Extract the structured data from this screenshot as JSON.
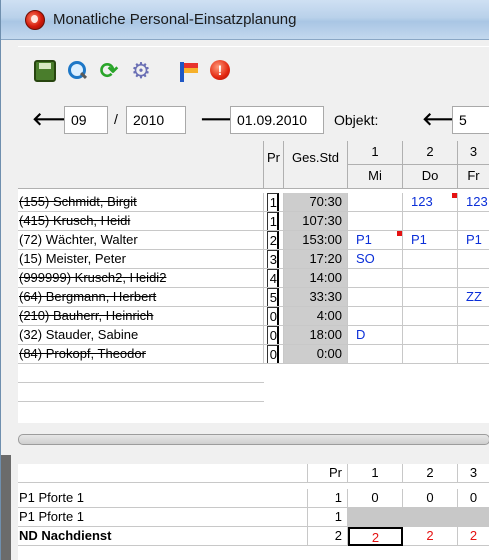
{
  "window": {
    "title": "Monatliche Personal-Einsatzplanung"
  },
  "toolbar": {
    "icons": [
      "save-icon",
      "search-icon",
      "refresh-icon",
      "settings-gear-icon",
      "legend-flag-icon",
      "stop-icon"
    ],
    "stop_glyph": "!"
  },
  "nav": {
    "prev_arrow": "🡐",
    "next_arrow": "🡒",
    "month": "09",
    "separator": "/",
    "year": "2010",
    "date": "01.09.2010",
    "object_label": "Objekt:",
    "object_prev_arrow": "🡐",
    "object_value": "5"
  },
  "grid": {
    "headers": {
      "pr": "Pr",
      "std": "Ges.Std"
    },
    "days": [
      {
        "num": "1",
        "weekday": "Mi"
      },
      {
        "num": "2",
        "weekday": "Do"
      },
      {
        "num": "3",
        "weekday": "Fr"
      }
    ],
    "rows": [
      {
        "name": "(155) Schmidt, Birgit",
        "strike": true,
        "pr": "1",
        "std": "70:30",
        "d1": "",
        "d2": "123",
        "d3": "123",
        "mark2": true
      },
      {
        "name": "(415) Krusch, Heidi",
        "strike": true,
        "pr": "1",
        "std": "107:30",
        "d1": "",
        "d2": "",
        "d3": ""
      },
      {
        "name": "(72) Wächter, Walter",
        "strike": false,
        "pr": "2",
        "std": "153:00",
        "d1": "P1",
        "d2": "P1",
        "d3": "P1",
        "mark1": true
      },
      {
        "name": "(15) Meister, Peter",
        "strike": false,
        "pr": "3",
        "std": "17:20",
        "d1": "SO",
        "d2": "",
        "d3": ""
      },
      {
        "name": "(999999) Krusch2, Heidi2",
        "strike": true,
        "pr": "4",
        "std": "14:00",
        "d1": "",
        "d2": "",
        "d3": ""
      },
      {
        "name": "(64) Bergmann, Herbert",
        "strike": true,
        "pr": "5",
        "std": "33:30",
        "d1": "",
        "d2": "",
        "d3": "ZZ"
      },
      {
        "name": "(210) Bauherr, Heinrich",
        "strike": true,
        "pr": "0",
        "std": "4:00",
        "d1": "",
        "d2": "",
        "d3": ""
      },
      {
        "name": "(32) Stauder, Sabine",
        "strike": false,
        "pr": "0",
        "std": "18:00",
        "d1": "D",
        "d2": "",
        "d3": ""
      },
      {
        "name": "(84) Prokopf, Theodor",
        "strike": true,
        "pr": "0",
        "std": "0:00",
        "d1": "",
        "d2": "",
        "d3": ""
      }
    ]
  },
  "summary": {
    "headers": {
      "pr": "Pr",
      "days": [
        "1",
        "2",
        "3"
      ]
    },
    "rows": [
      {
        "name": "P1 Pforte 1",
        "pr": "1",
        "values": [
          "0",
          "0",
          "0"
        ],
        "bold": false
      },
      {
        "name": "P1 Pforte 1",
        "pr": "1",
        "values": [
          "",
          "",
          ""
        ],
        "bold": false,
        "grey": true
      },
      {
        "name": "ND Nachdienst",
        "pr": "2",
        "values": [
          "2",
          "2",
          "2"
        ],
        "bold": true,
        "red": true
      }
    ]
  },
  "colors": {
    "shift_text": "#0b2fd8",
    "marker": "#e51212",
    "std_bg": "#cdcdcd",
    "summary_red": "#e51212"
  }
}
